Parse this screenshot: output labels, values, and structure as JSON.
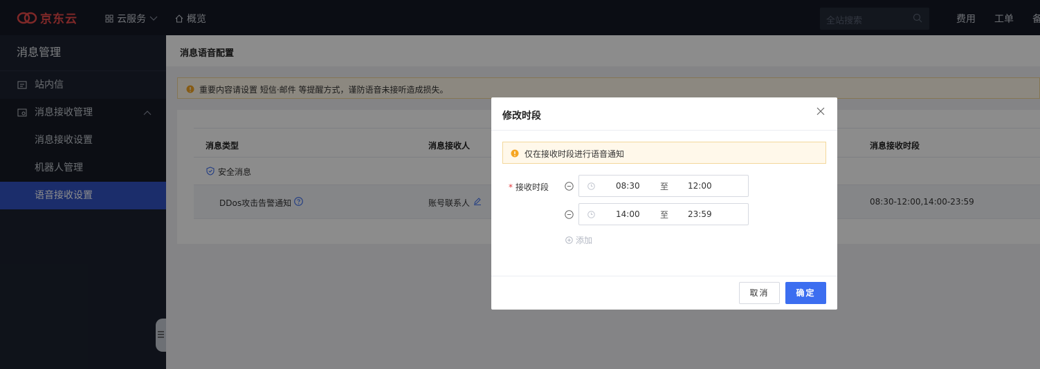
{
  "topbar": {
    "brand": "京东云",
    "nav": [
      {
        "label": "云服务",
        "icon": "grid-icon"
      },
      {
        "label": "概览",
        "icon": "home-icon"
      }
    ],
    "search_placeholder": "全站搜索",
    "links": [
      "费用",
      "工单",
      "备"
    ]
  },
  "sidebar": {
    "title": "消息管理",
    "items": [
      {
        "label": "站内信",
        "icon": "message-icon"
      },
      {
        "label": "消息接收管理",
        "icon": "mail-settings-icon"
      },
      {
        "label": "消息接收设置"
      },
      {
        "label": "机器人管理"
      },
      {
        "label": "语音接收设置"
      }
    ]
  },
  "page": {
    "title": "消息语音配置",
    "alert": "重要内容请设置 短信·邮件 等提醒方式，谨防语音未接听造成损失。",
    "table": {
      "headers": [
        "消息类型",
        "消息接收人",
        "消息接收时段"
      ],
      "group_label": "安全消息",
      "row": {
        "type": "DDos攻击告警通知",
        "receiver": "账号联系人",
        "period": "08:30-12:00,14:00-23:59"
      }
    }
  },
  "modal": {
    "title": "修改时段",
    "tip": "仅在接收时段进行语音通知",
    "field_label": "接收时段",
    "ranges": [
      {
        "start": "08:30",
        "sep": "至",
        "end": "12:00"
      },
      {
        "start": "14:00",
        "sep": "至",
        "end": "23:59"
      }
    ],
    "add_label": "添加",
    "cancel_label": "取消",
    "ok_label": "确定"
  },
  "colors": {
    "primary": "#3c6ef0",
    "sidebar_active": "#3253c3",
    "warning": "#f5a623",
    "brand_red": "#e84a4a"
  }
}
